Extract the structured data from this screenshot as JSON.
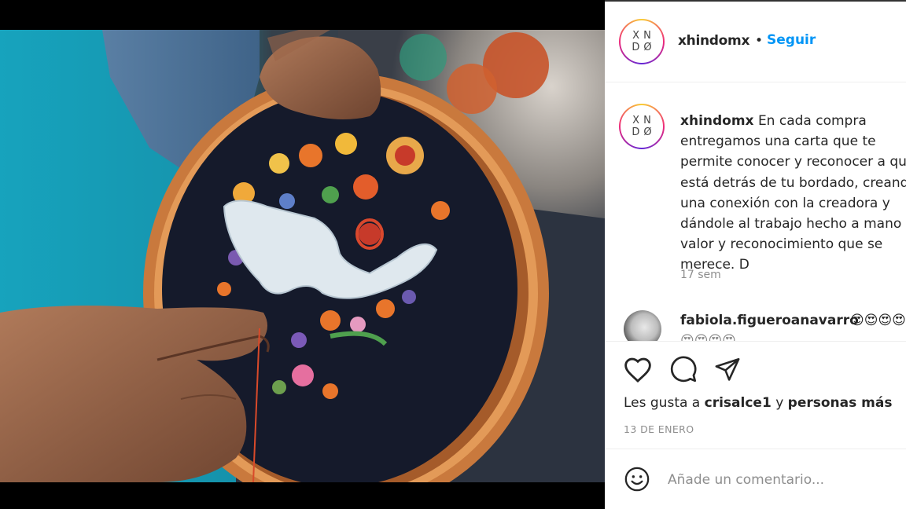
{
  "header": {
    "avatar_initials_top": "XN",
    "avatar_initials_bottom": "DØ",
    "username": "xhindomx",
    "separator": "•",
    "follow_label": "Seguir"
  },
  "caption": {
    "username": "xhindomx",
    "text": "En cada compra entregamos una carta que te permite conocer y reconocer a quien está detrás de tu bordado, creando una conexión con la creadora y dándole al trabajo hecho a mano el valor y reconocimiento que se merece. D",
    "time": "17 sem"
  },
  "comment": {
    "username": "fabiola.figueroanavarro",
    "text": "😍😍😍😍",
    "more": "😍😍😍😍"
  },
  "actions": {
    "like_icon": "heart-icon",
    "comment_icon": "comment-bubble-icon",
    "share_icon": "paper-plane-icon"
  },
  "likes": {
    "prefix": "Les gusta a",
    "user": "crisalce1",
    "connector": "y",
    "others": "personas más"
  },
  "date": "13 DE ENERO",
  "add_comment": {
    "placeholder": "Añade un comentario...",
    "emoji_icon": "emoji-icon"
  },
  "colors": {
    "link": "#0095f6",
    "muted": "#8e8e8e",
    "text": "#262626"
  }
}
